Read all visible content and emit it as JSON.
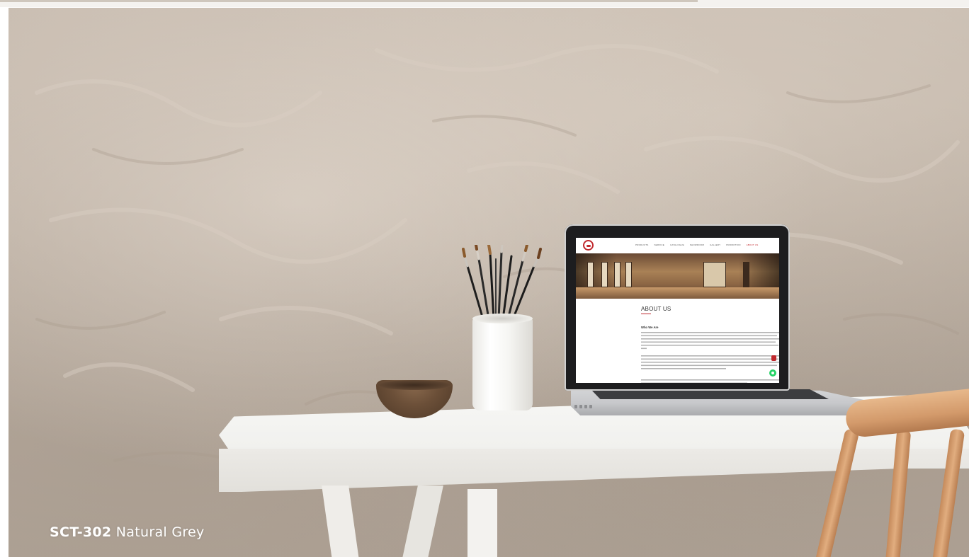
{
  "caption": {
    "code": "SCT-302",
    "name": "Natural Grey"
  },
  "laptop_site": {
    "nav_items": [
      "PRODUCTS",
      "SERVICE",
      "CATALOGUE",
      "SHOWROOM",
      "GALLERY",
      "PROMOTION",
      "ABOUT US"
    ],
    "active_nav_item": "ABOUT US",
    "page_heading": "ABOUT US",
    "section_heading": "Who We Are"
  },
  "colors": {
    "wall": "#bfb3a7",
    "caption_text": "#ffffff",
    "brand_accent": "#c0282d",
    "whatsapp_green": "#25d366"
  },
  "icons": [
    "site-logo-icon",
    "whatsapp-icon"
  ]
}
